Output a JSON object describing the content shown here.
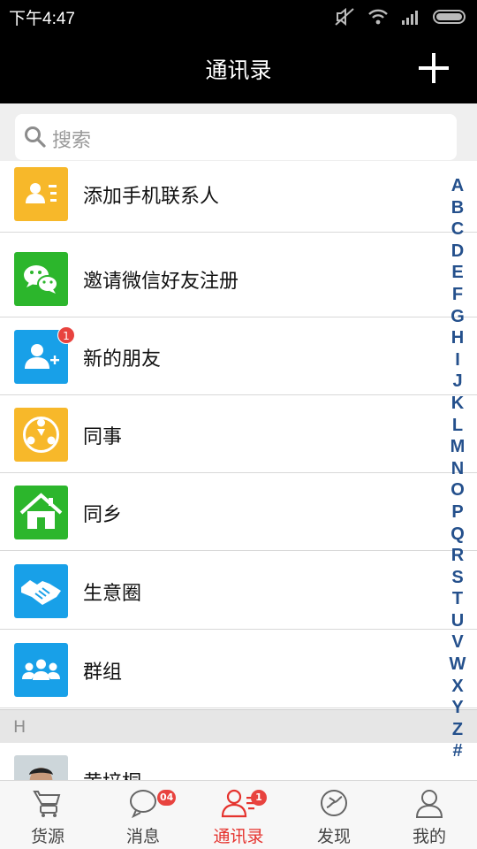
{
  "status_bar": {
    "time": "下午4:47"
  },
  "header": {
    "title": "通讯录",
    "add_icon": "plus-icon"
  },
  "search": {
    "placeholder": "搜索"
  },
  "menu_items": [
    {
      "label": "添加手机联系人",
      "icon": "contact-card-icon",
      "color": "#f7b82a"
    },
    {
      "label": "邀请微信好友注册",
      "icon": "wechat-icon",
      "color": "#2cb62c"
    },
    {
      "label": "新的朋友",
      "icon": "add-friend-icon",
      "color": "#18a0e8",
      "badge": "1"
    },
    {
      "label": "同事",
      "icon": "colleagues-icon",
      "color": "#f7b82a"
    },
    {
      "label": "同乡",
      "icon": "home-icon",
      "color": "#2cb62c"
    },
    {
      "label": "生意圈",
      "icon": "handshake-icon",
      "color": "#18a0e8"
    },
    {
      "label": "群组",
      "icon": "group-icon",
      "color": "#18a0e8"
    }
  ],
  "section": {
    "label": "H"
  },
  "contact": {
    "name": "黄培桐"
  },
  "alphabet": [
    "A",
    "B",
    "C",
    "D",
    "E",
    "F",
    "G",
    "H",
    "I",
    "J",
    "K",
    "L",
    "M",
    "N",
    "O",
    "P",
    "Q",
    "R",
    "S",
    "T",
    "U",
    "V",
    "W",
    "X",
    "Y",
    "Z",
    "#"
  ],
  "tabs": [
    {
      "label": "货源",
      "icon": "cart-icon",
      "active": false
    },
    {
      "label": "消息",
      "icon": "chat-bubble-icon",
      "active": false,
      "badge": "04"
    },
    {
      "label": "通讯录",
      "icon": "contacts-icon",
      "active": true,
      "badge": "1"
    },
    {
      "label": "发现",
      "icon": "discover-icon",
      "active": false
    },
    {
      "label": "我的",
      "icon": "profile-icon",
      "active": false
    }
  ],
  "colors": {
    "accent": "#e5332e",
    "index_letters": "#24508c"
  }
}
